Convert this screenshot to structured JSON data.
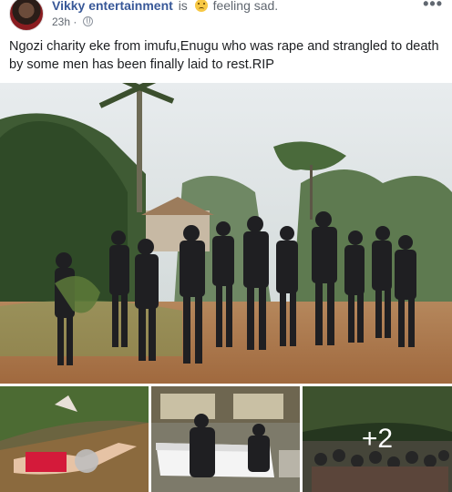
{
  "post": {
    "author": "Vikky entertainment",
    "is_word": "is",
    "feeling": "feeling sad.",
    "time": "23h",
    "more_label": "•••",
    "text": "Ngozi charity eke from imufu,Enugu who was rape and strangled to death by some men has been finally laid to rest.RIP"
  },
  "photos": {
    "main": {
      "icon": "funeral-procession-photo"
    },
    "thumbs": [
      {
        "icon": "victim-photo"
      },
      {
        "icon": "casket-photo"
      },
      {
        "icon": "crowd-photo",
        "overlay": "+2"
      }
    ]
  },
  "colors": {
    "name": "#385898",
    "meta": "#606770",
    "text": "#1c1e21"
  }
}
